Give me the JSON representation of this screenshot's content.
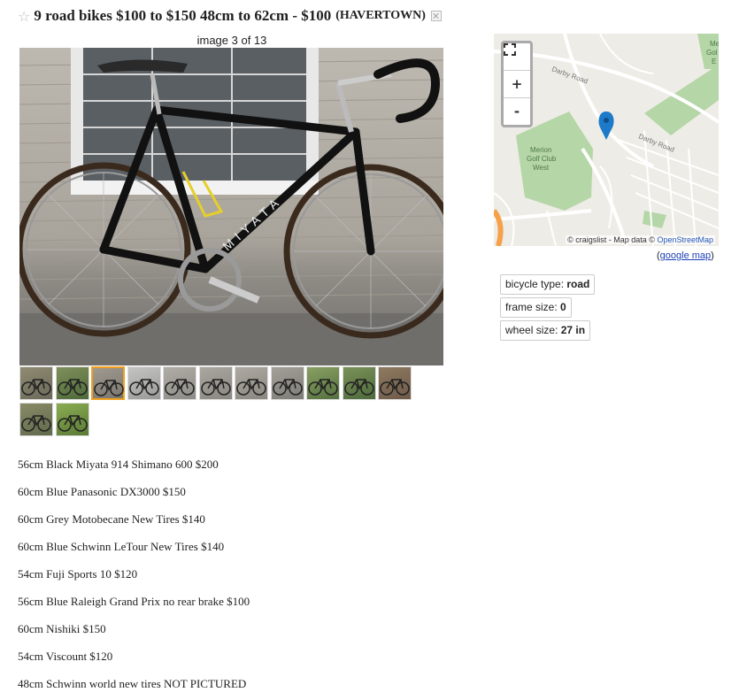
{
  "header": {
    "title": "9 road bikes $100 to $150 48cm to 62cm - $100",
    "location": "(HAVERTOWN)",
    "star_glyph": "☆"
  },
  "gallery": {
    "counter": "image 3 of 13",
    "thumbnail_count": 13,
    "selected_index": 3
  },
  "bike": {
    "frame_decal": "MIYATA"
  },
  "map": {
    "labels": {
      "darby1": "Darby Road",
      "darby2": "Darby Road",
      "golf1": "Merion",
      "golf2": "Golf Club",
      "golf3": "West",
      "corner1": "Me",
      "corner2": "Gol",
      "corner3": "E"
    },
    "attribution_prefix": "© craigslist - Map data ©",
    "attribution_link": "OpenStreetMap",
    "google_link": "google map",
    "zoom_in": "+",
    "zoom_out": "-",
    "colors": {
      "park": "#b5d6a7",
      "road": "#ffffff",
      "pin": "#1d7ac9",
      "background": "#eeece6"
    }
  },
  "attributes": [
    {
      "label": "bicycle type: ",
      "value": "road"
    },
    {
      "label": "frame size: ",
      "value": "0"
    },
    {
      "label": "wheel size: ",
      "value": "27 in"
    }
  ],
  "description": [
    "56cm Black Miyata 914 Shimano 600 $200",
    "60cm Blue Panasonic DX3000 $150",
    "60cm Grey Motobecane New Tires $140",
    "60cm Blue Schwinn LeTour New Tires $140",
    "54cm Fuji Sports 10 $120",
    "56cm Blue Raleigh Grand Prix no rear brake $100",
    "60cm Nishiki $150",
    "54cm Viscount $120",
    "48cm Schwinn world new tires NOT PICTURED"
  ]
}
